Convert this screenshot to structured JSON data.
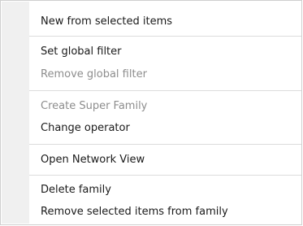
{
  "menu": {
    "items": [
      {
        "label": "New from selected items",
        "enabled": true
      },
      {
        "label": "Set global filter",
        "enabled": true
      },
      {
        "label": "Remove global filter",
        "enabled": false
      },
      {
        "label": "Create Super Family",
        "enabled": false
      },
      {
        "label": "Change operator",
        "enabled": true
      },
      {
        "label": "Open Network View",
        "enabled": true
      },
      {
        "label": "Delete family",
        "enabled": true
      },
      {
        "label": "Remove selected items from family",
        "enabled": true
      }
    ]
  }
}
